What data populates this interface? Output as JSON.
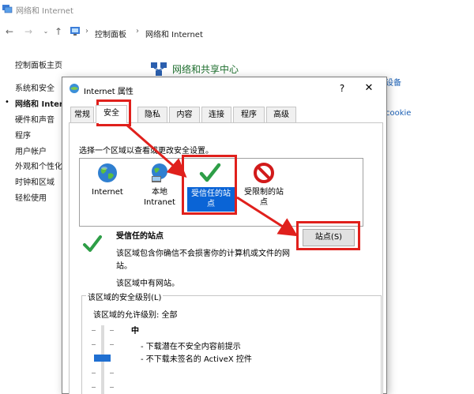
{
  "window": {
    "title": "网络和 Internet"
  },
  "address_bar": {
    "crumbs": [
      "控制面板",
      "网络和 Internet"
    ]
  },
  "sidebar": {
    "home": "控制面板主页",
    "items": [
      "系统和安全",
      "网络和 Internet",
      "硬件和声音",
      "程序",
      "用户帐户",
      "外观和个性化",
      "时钟和区域",
      "轻松使用"
    ],
    "active_index": 1
  },
  "main": {
    "section_title": "网络和共享中心",
    "link_fragment_1": "设备",
    "link_fragment_2": "cookie"
  },
  "dialog": {
    "title": "Internet 属性",
    "help_glyph": "?",
    "close_glyph": "✕",
    "tabs": [
      "常规",
      "安全",
      "隐私",
      "内容",
      "连接",
      "程序",
      "高级"
    ],
    "selected_tab": "安全",
    "zone_prompt": "选择一个区域以查看或更改安全设置。",
    "zones": [
      {
        "label": "Internet",
        "icon": "globe-icon"
      },
      {
        "label": "本地\nIntranet",
        "icon": "intranet-icon"
      },
      {
        "label": "受信任的站\n点",
        "icon": "checkmark-icon",
        "selected": true
      },
      {
        "label": "受限制的站\n点",
        "icon": "restricted-icon"
      }
    ],
    "zone_info": {
      "title": "受信任的站点",
      "description": "该区域包含你确信不会损害你的计算机或文件的网站。",
      "empty_note": "该区域中有网站。"
    },
    "sites_button": "站点(S)",
    "security_level": {
      "legend": "该区域的安全级别(L)",
      "allowed": "该区域的允许级别: 全部",
      "level_name": "中",
      "bullets": [
        "- 下载潜在不安全内容前提示",
        "- 不下载未签名的 ActiveX 控件"
      ]
    }
  },
  "colors": {
    "highlight_red": "#e0201c",
    "selection_blue": "#0a64d6",
    "check_green": "#2e9e47",
    "title_green": "#1e6e2e",
    "link_blue": "#1a5fb4"
  }
}
